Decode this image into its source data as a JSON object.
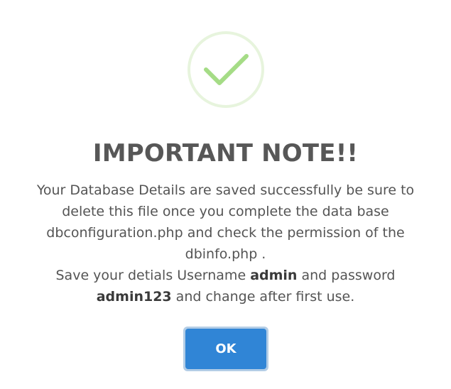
{
  "dialog": {
    "icon": "success-check-icon",
    "title": "IMPORTANT NOTE!!",
    "message_line1": "Your Database Details are saved successfully be sure to delete this file once you complete the data base dbconfiguration.php and check the permission of the dbinfo.php .",
    "message_line2_prefix": "Save your detials Username ",
    "username": "admin",
    "message_line2_mid": " and password ",
    "password": "admin123",
    "message_line2_suffix": " and change after first use.",
    "ok_label": "OK"
  },
  "colors": {
    "success_ring": "#e7f4dd",
    "success_check": "#a5dc86",
    "confirm_button": "#3085d6",
    "title_text": "#575757"
  }
}
